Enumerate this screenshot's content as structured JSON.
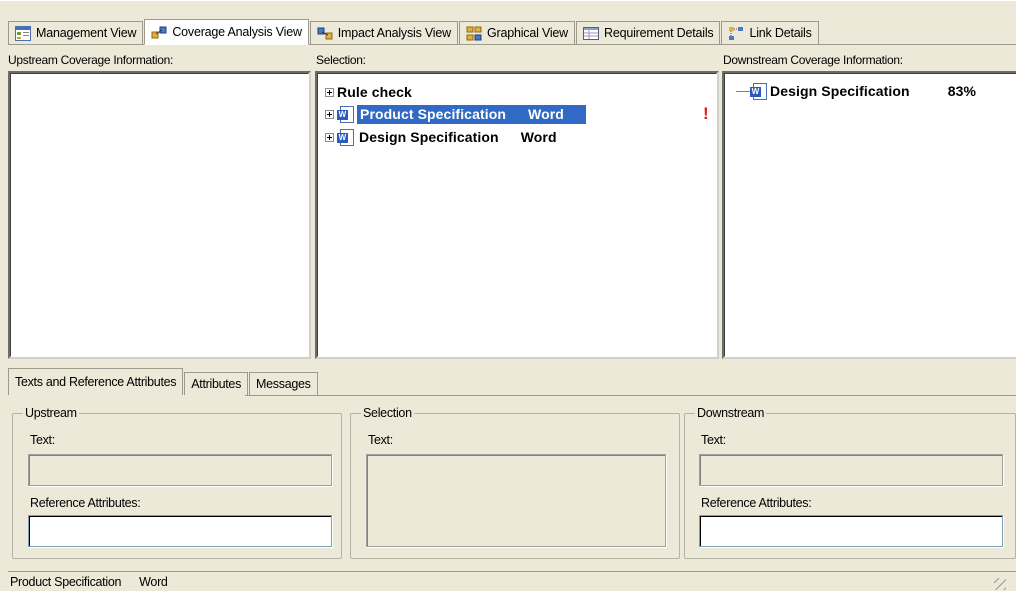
{
  "tabs": [
    {
      "label": "Management View",
      "icon": "management-view-icon"
    },
    {
      "label": "Coverage Analysis View",
      "icon": "coverage-analysis-icon",
      "active": true
    },
    {
      "label": "Impact Analysis View",
      "icon": "impact-analysis-icon"
    },
    {
      "label": "Graphical View",
      "icon": "graphical-view-icon"
    },
    {
      "label": "Requirement Details",
      "icon": "requirement-details-icon"
    },
    {
      "label": "Link Details",
      "icon": "link-details-icon"
    }
  ],
  "upstream_pane": {
    "header": "Upstream Coverage Information:"
  },
  "selection_pane": {
    "header": "Selection:",
    "items": [
      {
        "name": "Rule check",
        "type": ""
      },
      {
        "name": "Product Specification",
        "type": "Word",
        "selected": true,
        "warning": "!"
      },
      {
        "name": "Design Specification",
        "type": "Word"
      }
    ]
  },
  "downstream_pane": {
    "header": "Downstream Coverage Information:",
    "items": [
      {
        "name": "Design Specification",
        "coverage": "83%"
      }
    ]
  },
  "bottom_tabs": [
    {
      "label": "Texts and Reference Attributes",
      "active": true
    },
    {
      "label": "Attributes"
    },
    {
      "label": "Messages"
    }
  ],
  "groups": {
    "upstream": {
      "legend": "Upstream",
      "text_label": "Text:",
      "ref_label": "Reference Attributes:"
    },
    "selection": {
      "legend": "Selection",
      "text_label": "Text:"
    },
    "downstream": {
      "legend": "Downstream",
      "text_label": "Text:",
      "ref_label": "Reference Attributes:"
    }
  },
  "status_bar": {
    "name": "Product Specification",
    "type": "Word"
  },
  "colors": {
    "selection_bg": "#316ac5",
    "warning": "#e01b1b",
    "window_bg": "#ece9d8"
  }
}
